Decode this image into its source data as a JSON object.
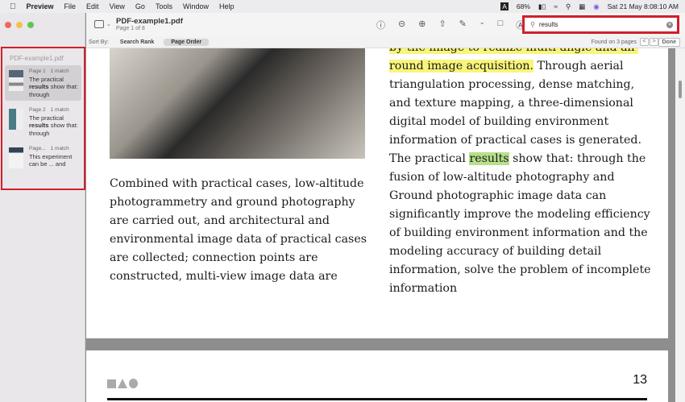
{
  "menubar": {
    "app": "Preview",
    "items": [
      "File",
      "Edit",
      "View",
      "Go",
      "Tools",
      "Window",
      "Help"
    ],
    "battery": "68%",
    "datetime": "Sat 21 May  8:08:10 AM"
  },
  "toolbar": {
    "title": "PDF-example1.pdf",
    "subtitle": "Page 1 of 8",
    "search_value": "results"
  },
  "sortbar": {
    "label": "Sort By:",
    "search_rank": "Search Rank",
    "page_order": "Page Order",
    "found": "Found on 3 pages",
    "prev": "<",
    "next": ">",
    "done": "Done"
  },
  "sidebar": {
    "title": "PDF-example1.pdf",
    "results": [
      {
        "page": "Page 1",
        "count": "1 match",
        "pre": "The practical ",
        "match": "results",
        "post": " show that: through"
      },
      {
        "page": "Page 2",
        "count": "1 match",
        "pre": "The practical ",
        "match": "results",
        "post": " show that: through"
      },
      {
        "page": "Page...",
        "count": "1 match",
        "pre": "This experiment can be ... and",
        "match": "",
        "post": ""
      }
    ]
  },
  "doc": {
    "left": "Combined with practical cases, low-altitude photogrammetry and ground photography are carried out, and architectural and environmental image data of practical cases are collected; connection points are constructed, multi-view image data are",
    "right_hl": "by the image to realize multi-angle and all-round image acquisition.",
    "right_a": " Through aerial triangulation processing, dense matching, and texture mapping, a three-dimensional digital model of building environment information of practical cases is generated. The practical ",
    "right_match": "results",
    "right_b": " show that: through the fusion of low-altitude photography and Ground photographic image data can significantly improve the modeling efficiency of building environment information and the modeling accuracy of building detail information, solve the problem of incomplete information",
    "page_number": "13"
  }
}
